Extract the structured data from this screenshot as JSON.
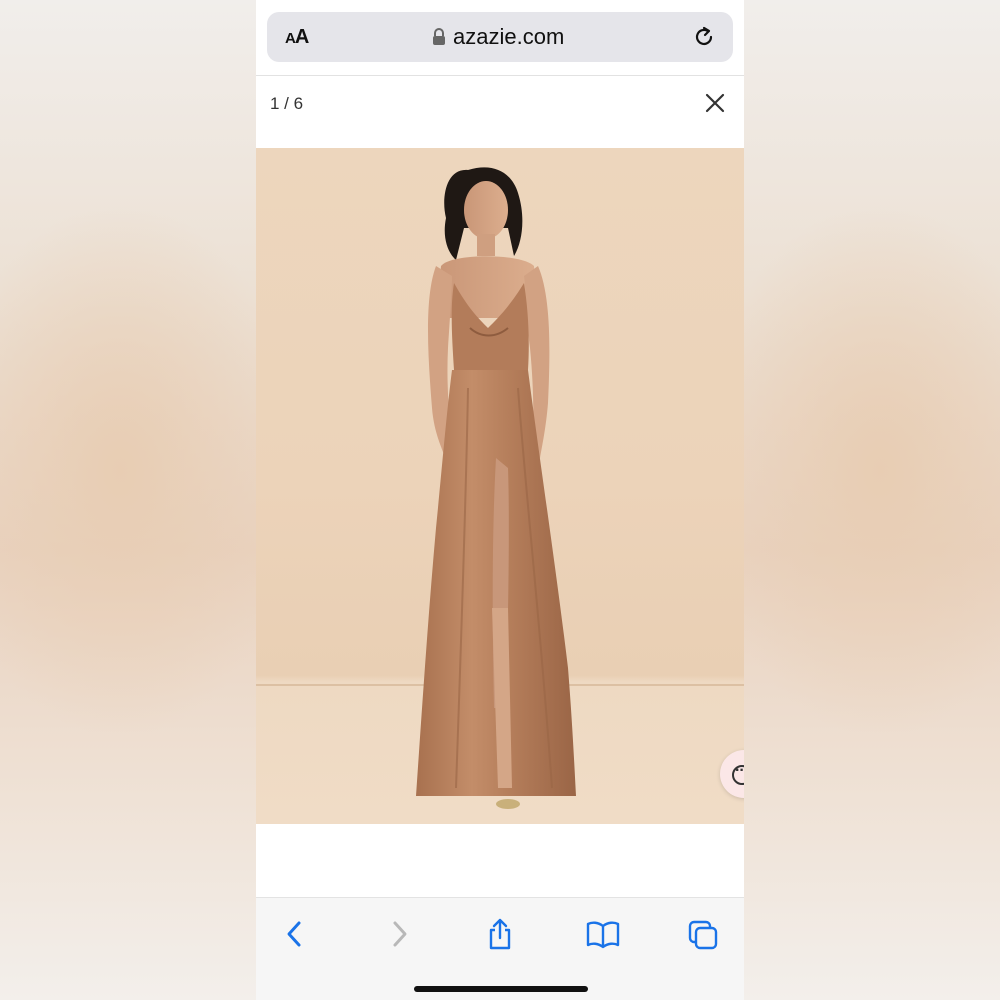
{
  "browser": {
    "text_size_label_small": "A",
    "text_size_label_large": "A",
    "domain": "azazie.com"
  },
  "gallery": {
    "counter": "1 / 6"
  },
  "colors": {
    "accent": "#1a73e8",
    "dress": "#b9825f",
    "backdrop": "#ecd3b9"
  },
  "icons": {
    "lock": "lock-icon",
    "reload": "reload-icon",
    "close": "close-icon",
    "chat": "chat-icon",
    "back": "chevron-left-icon",
    "forward": "chevron-right-icon",
    "share": "share-icon",
    "bookmarks": "book-icon",
    "tabs": "tabs-icon"
  }
}
